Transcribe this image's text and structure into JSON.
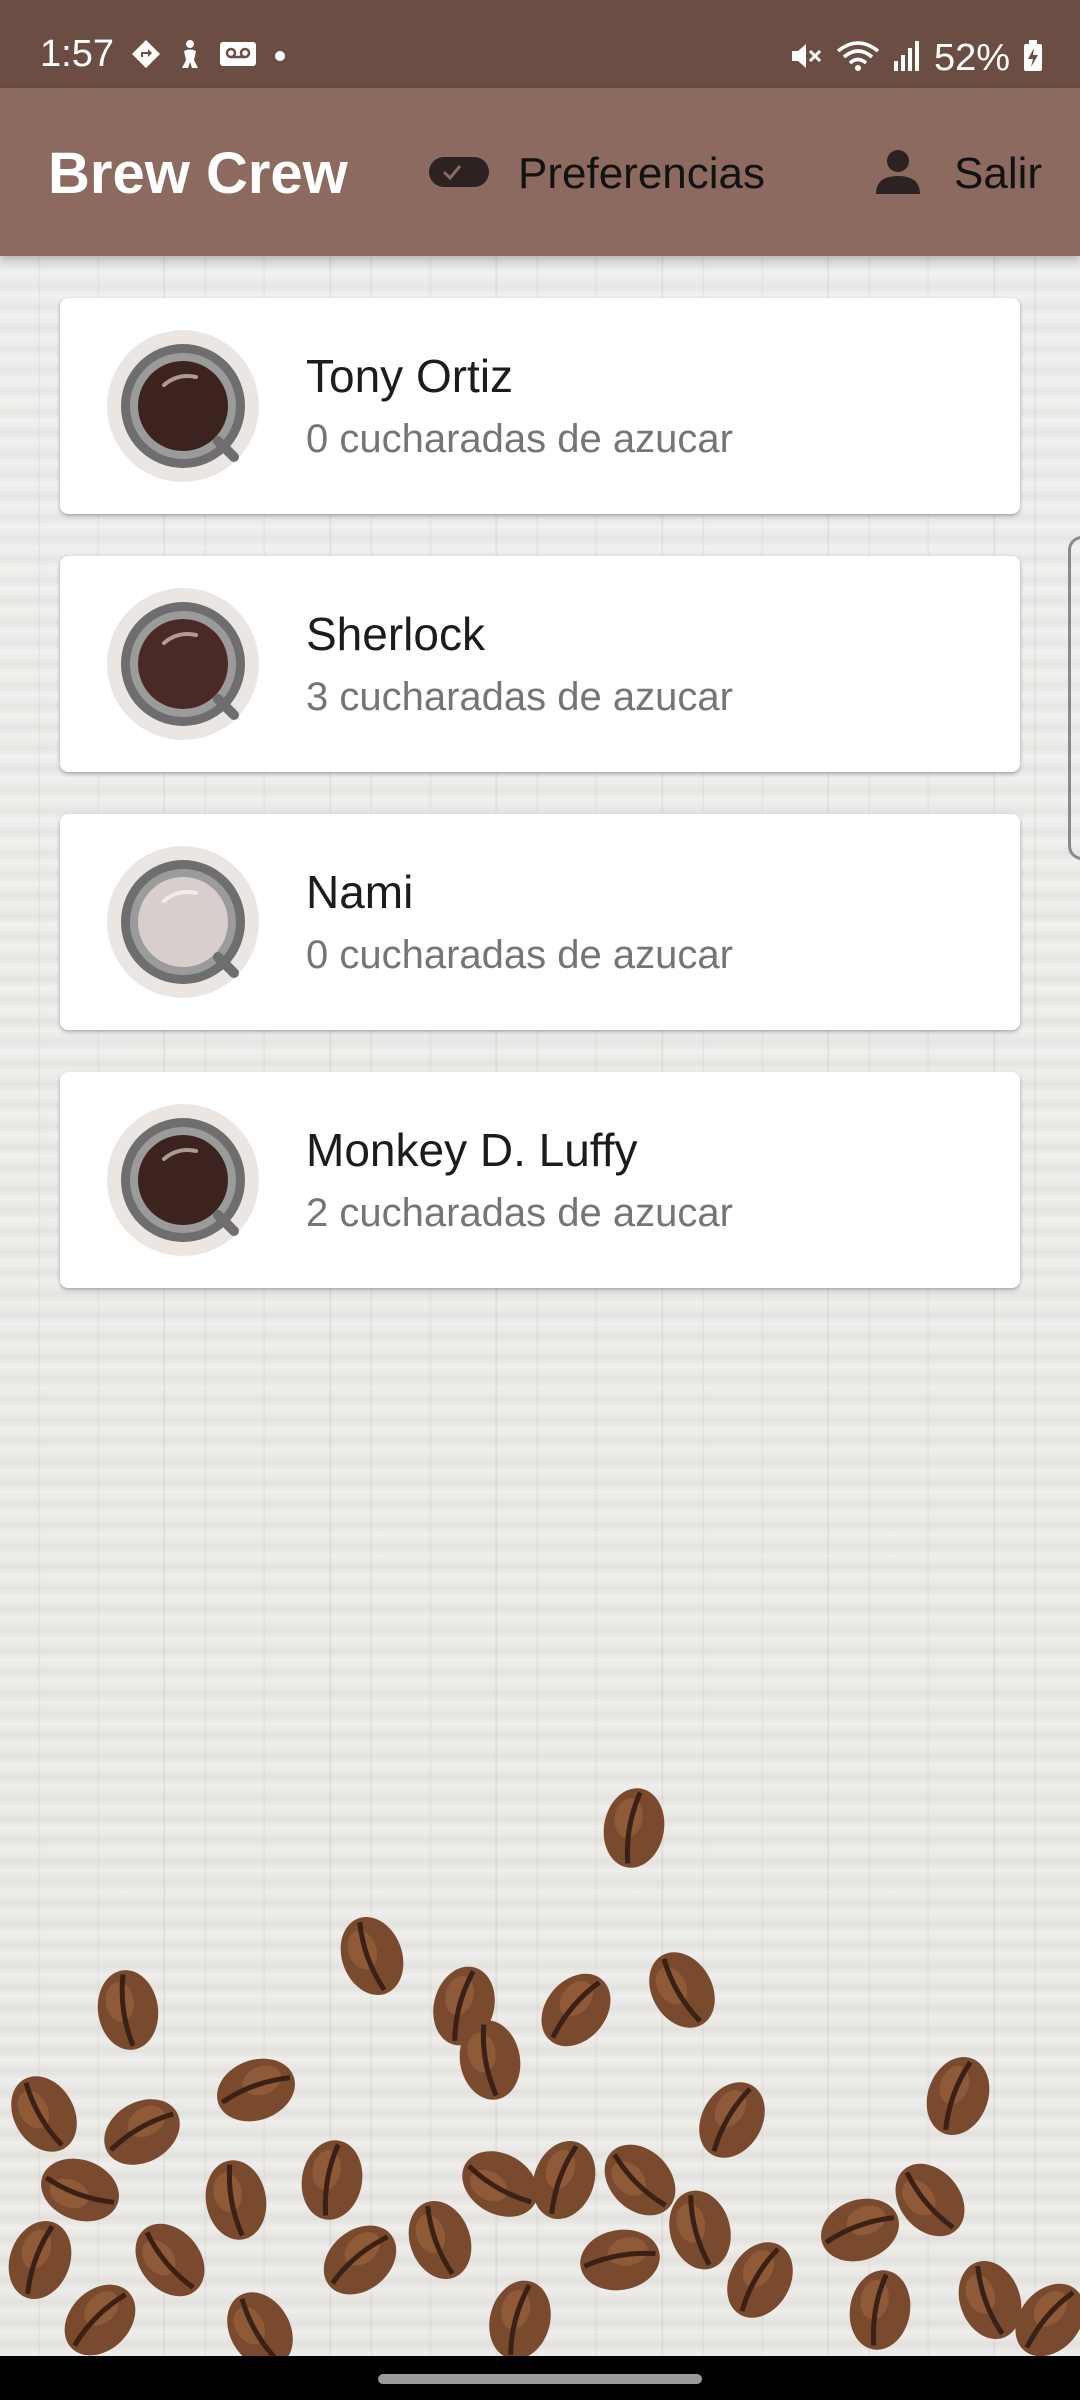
{
  "status_bar": {
    "time": "1:57",
    "battery": "52%",
    "left_icons": [
      "maps-navigation-icon",
      "accessibility-icon",
      "voicemail-icon",
      "notification-dot-icon"
    ],
    "right_icons": [
      "mute-icon",
      "wifi-icon",
      "signal-icon",
      "battery-charging-icon"
    ]
  },
  "app_bar": {
    "title": "Brew Crew",
    "preferences_label": "Preferencias",
    "logout_label": "Salir",
    "background_color": "#8c6a5f"
  },
  "brews": [
    {
      "name": "Tony Ortiz",
      "sugars": "0 cucharadas de azucar",
      "coffee_color": "#3d2320"
    },
    {
      "name": "Sherlock",
      "sugars": "3 cucharadas de azucar",
      "coffee_color": "#4a2a26"
    },
    {
      "name": "Nami",
      "sugars": "0 cucharadas de azucar",
      "coffee_color": "#d8cfcc"
    },
    {
      "name": "Monkey D. Luffy",
      "sugars": "2 cucharadas de azucar",
      "coffee_color": "#3d2320"
    }
  ],
  "colors": {
    "status_bar": "#6b4d43",
    "app_bar": "#8c6a5f",
    "card": "#ffffff",
    "bean": "#7a4a2e"
  }
}
